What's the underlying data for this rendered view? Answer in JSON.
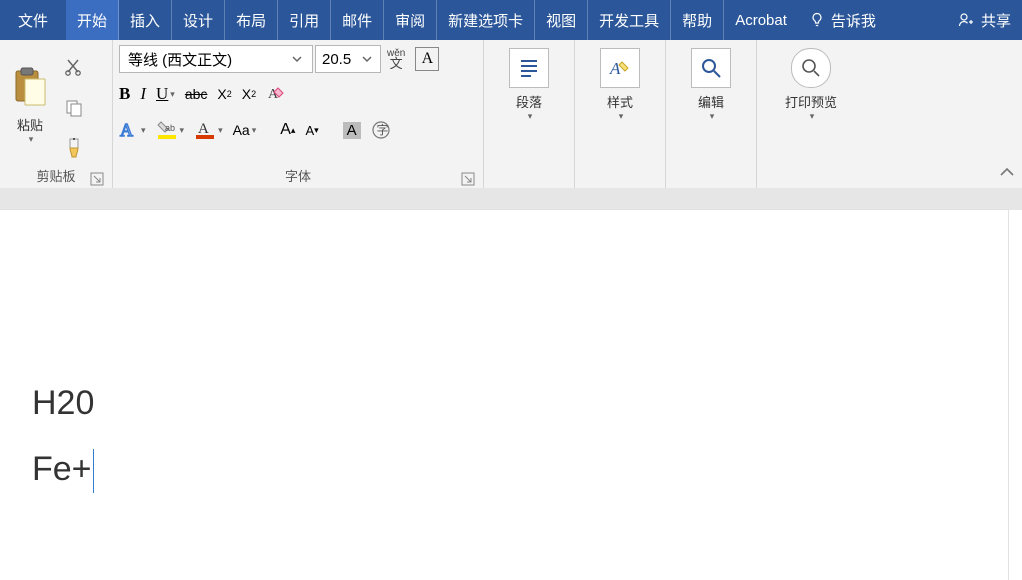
{
  "tabs": {
    "file": "文件",
    "home": "开始",
    "insert": "插入",
    "design": "设计",
    "layout": "布局",
    "references": "引用",
    "mailings": "邮件",
    "review": "审阅",
    "newtab": "新建选项卡",
    "view": "视图",
    "developer": "开发工具",
    "help": "帮助",
    "acrobat": "Acrobat",
    "tellme": "告诉我",
    "share": "共享"
  },
  "clipboard": {
    "label": "剪贴板",
    "paste": "粘贴"
  },
  "font": {
    "label": "字体",
    "name": "等线 (西文正文)",
    "size": "20.5",
    "phonetic_top": "wěn",
    "phonetic_bottom": "文"
  },
  "paragraph": {
    "label": "段落"
  },
  "styles": {
    "label": "样式"
  },
  "editing": {
    "label": "编辑"
  },
  "printpreview": {
    "label": "打印预览"
  },
  "document": {
    "line1": "H20",
    "line2": "Fe+"
  }
}
